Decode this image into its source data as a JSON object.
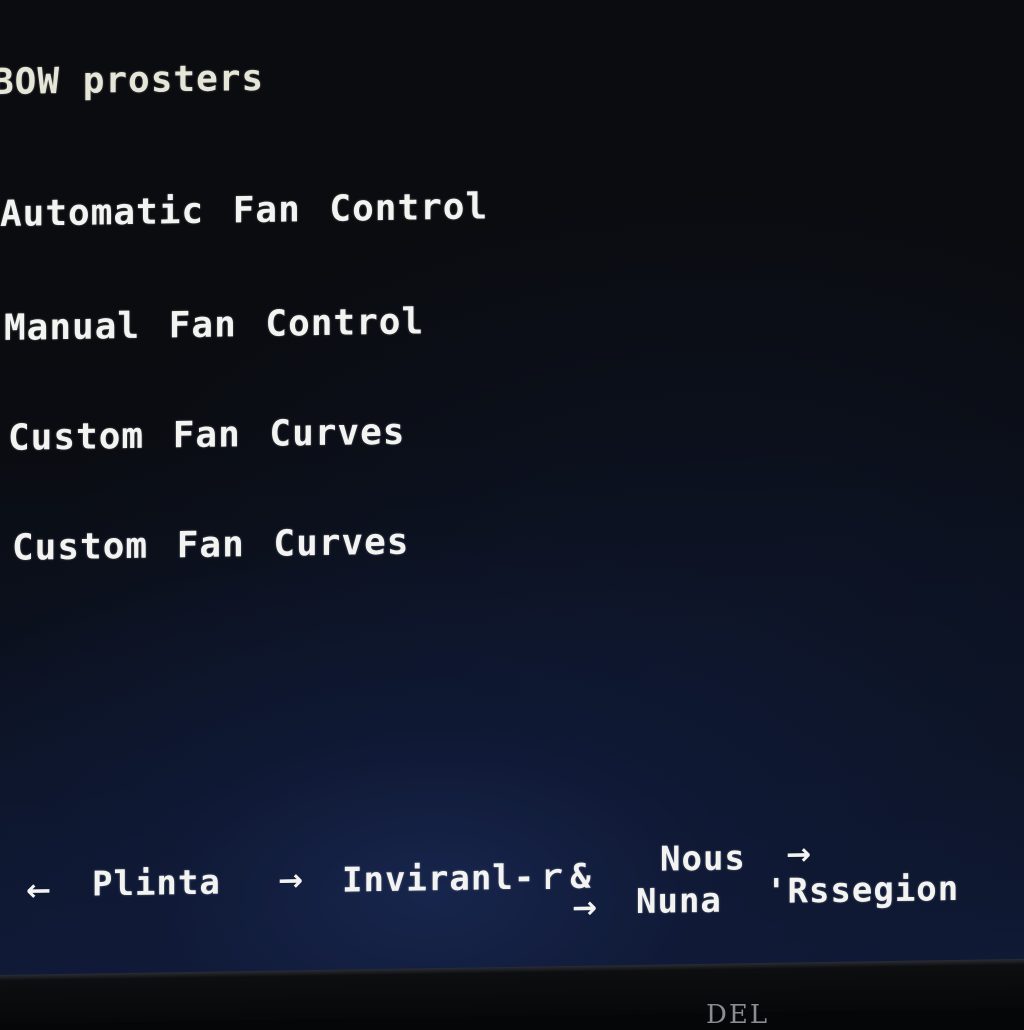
{
  "screen": {
    "header": "BOW prosters",
    "menu": {
      "items": [
        {
          "label": "Automatic Fan Control"
        },
        {
          "label": "Manual Fan Control"
        },
        {
          "label": "Custom Fan Curves"
        },
        {
          "label": "Custom Fan Curves"
        }
      ]
    },
    "footer": {
      "left_arrow_icon": "←",
      "item1": "Plinta",
      "arrow2_icon": "→",
      "item2": "Inviranl-ｒ&",
      "item3": "Nous",
      "arrow3_icon": "→",
      "arrow4_icon": "→",
      "item4": "Nuna",
      "item5": "'Rssegion"
    }
  },
  "bezel": {
    "logo": "DEL"
  },
  "colors": {
    "text": "#f3f4f2",
    "background_top": "#0b0c0f",
    "background_bottom": "#101b38"
  }
}
